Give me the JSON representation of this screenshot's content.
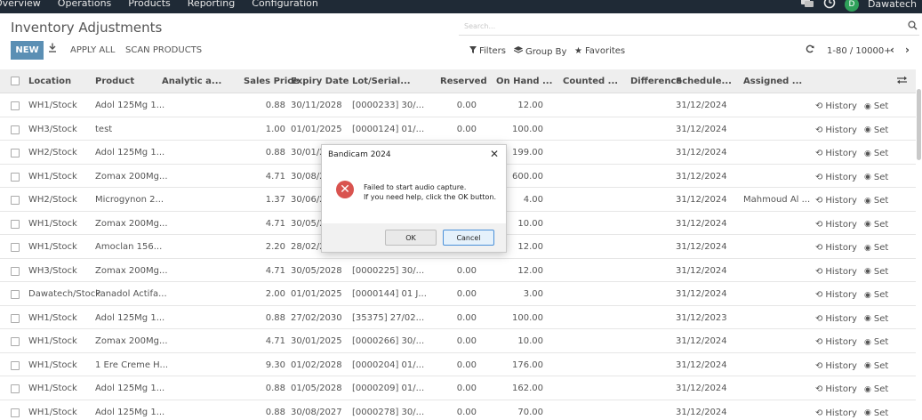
{
  "topnav": {
    "items": [
      "Overview",
      "Operations",
      "Products",
      "Reporting",
      "Configuration"
    ],
    "avatar_letter": "D",
    "company": "Dawatech"
  },
  "page": {
    "title": "Inventory Adjustments",
    "search_placeholder": "Search..."
  },
  "toolbar": {
    "new_label": "NEW",
    "apply_all_label": "APPLY ALL",
    "scan_label": "SCAN PRODUCTS",
    "filters_label": "Filters",
    "group_by_label": "Group By",
    "favorites_label": "Favorites",
    "pager": "1-80 / 10000+"
  },
  "table": {
    "headers": {
      "location": "Location",
      "product": "Product",
      "analytic": "Analytic a...",
      "sales_price": "Sales Price",
      "expiry": "Expiry Date",
      "lot": "Lot/Serial...",
      "reserved": "Reserved",
      "on_hand": "On Hand ...",
      "counted": "Counted ...",
      "difference": "Difference",
      "scheduled": "Schedule...",
      "assigned": "Assigned ..."
    },
    "history_label": "History",
    "set_label": "Set",
    "rows": [
      {
        "location": "WH1/Stock",
        "product": "Adol 125Mg 1...",
        "price": "0.88",
        "expiry": "30/11/2028",
        "lot": "[0000233] 30/...",
        "reserved": "0.00",
        "on_hand": "12.00",
        "scheduled": "31/12/2024",
        "assigned": ""
      },
      {
        "location": "WH3/Stock",
        "product": "test",
        "price": "1.00",
        "expiry": "01/01/2025",
        "lot": "[0000124] 01/...",
        "reserved": "0.00",
        "on_hand": "100.00",
        "scheduled": "31/12/2024",
        "assigned": ""
      },
      {
        "location": "WH2/Stock",
        "product": "Adol 125Mg 1...",
        "price": "0.88",
        "expiry": "30/01/20",
        "lot": "",
        "reserved": "",
        "on_hand": "199.00",
        "scheduled": "31/12/2024",
        "assigned": ""
      },
      {
        "location": "WH1/Stock",
        "product": "Zomax 200Mg...",
        "price": "4.71",
        "expiry": "30/08/20",
        "lot": "",
        "reserved": "",
        "on_hand": "600.00",
        "scheduled": "31/12/2024",
        "assigned": ""
      },
      {
        "location": "WH2/Stock",
        "product": "Microgynon 2...",
        "price": "1.37",
        "expiry": "30/06/20",
        "lot": "",
        "reserved": "",
        "on_hand": "4.00",
        "scheduled": "31/12/2024",
        "assigned": "Mahmoud Al ..."
      },
      {
        "location": "WH1/Stock",
        "product": "Zomax 200Mg...",
        "price": "4.71",
        "expiry": "30/05/20",
        "lot": "",
        "reserved": "",
        "on_hand": "10.00",
        "scheduled": "31/12/2024",
        "assigned": ""
      },
      {
        "location": "WH1/Stock",
        "product": "Amoclan 156...",
        "price": "2.20",
        "expiry": "28/02/20",
        "lot": "",
        "reserved": "",
        "on_hand": "12.00",
        "scheduled": "31/12/2024",
        "assigned": ""
      },
      {
        "location": "WH3/Stock",
        "product": "Zomax 200Mg...",
        "price": "4.71",
        "expiry": "30/05/2028",
        "lot": "[0000225] 30/...",
        "reserved": "0.00",
        "on_hand": "12.00",
        "scheduled": "31/12/2024",
        "assigned": ""
      },
      {
        "location": "Dawatech/Stock",
        "product": "Panadol Actifa...",
        "price": "2.00",
        "expiry": "01/01/2025",
        "lot": "[0000144] 01 J...",
        "reserved": "0.00",
        "on_hand": "3.00",
        "scheduled": "31/12/2024",
        "assigned": ""
      },
      {
        "location": "WH1/Stock",
        "product": "Adol 125Mg 1...",
        "price": "0.88",
        "expiry": "27/02/2030",
        "lot": "[35375] 27/02...",
        "reserved": "0.00",
        "on_hand": "100.00",
        "scheduled": "31/12/2023",
        "assigned": ""
      },
      {
        "location": "WH1/Stock",
        "product": "Zomax 200Mg...",
        "price": "4.71",
        "expiry": "30/01/2025",
        "lot": "[0000266] 30/...",
        "reserved": "0.00",
        "on_hand": "10.00",
        "scheduled": "31/12/2024",
        "assigned": ""
      },
      {
        "location": "WH1/Stock",
        "product": "1 Ere Creme H...",
        "price": "9.30",
        "expiry": "01/02/2028",
        "lot": "[0000204] 01/...",
        "reserved": "0.00",
        "on_hand": "176.00",
        "scheduled": "31/12/2024",
        "assigned": ""
      },
      {
        "location": "WH1/Stock",
        "product": "Adol 125Mg 1...",
        "price": "0.88",
        "expiry": "01/05/2028",
        "lot": "[0000209] 01/...",
        "reserved": "0.00",
        "on_hand": "162.00",
        "scheduled": "31/12/2024",
        "assigned": ""
      },
      {
        "location": "WH1/Stock",
        "product": "Adol 125Mg 1...",
        "price": "0.88",
        "expiry": "30/08/2027",
        "lot": "[0000278] 30/...",
        "reserved": "0.00",
        "on_hand": "70.00",
        "scheduled": "31/12/2024",
        "assigned": ""
      }
    ]
  },
  "dialog": {
    "title": "Bandicam 2024",
    "message_line1": "Failed to start audio capture.",
    "message_line2": "If you need help, click the OK button.",
    "ok_label": "OK",
    "cancel_label": "Cancel"
  }
}
